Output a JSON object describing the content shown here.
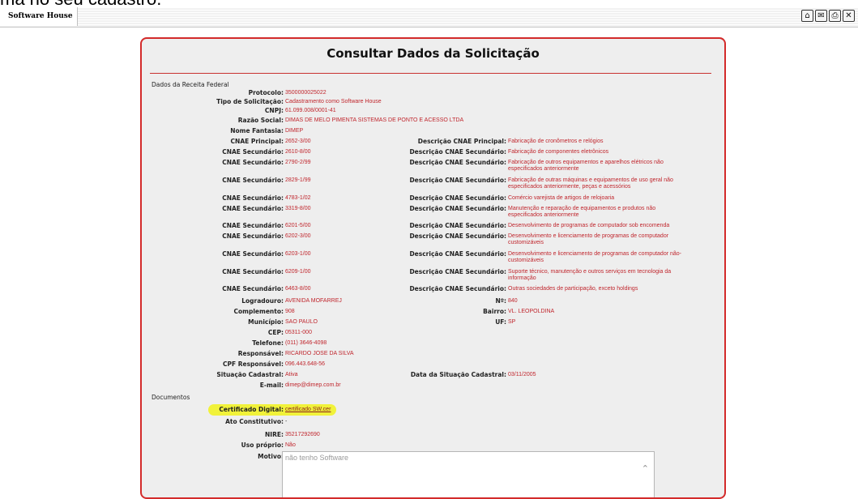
{
  "page": {
    "top_caption": "ma no seu cadastro.",
    "app_title": "Software House",
    "top_icons": [
      "home-icon",
      "mail-icon",
      "print-icon",
      "close-icon"
    ]
  },
  "panel": {
    "title": "Consultar Dados da Solicitação",
    "section_receita": "Dados da Receita Federal",
    "section_documentos": "Documentos"
  },
  "fields": {
    "protocolo": {
      "label": "Protocolo:",
      "value": "3500000025022"
    },
    "tipo": {
      "label": "Tipo de Solicitação:",
      "value": "Cadastramento como Software House"
    },
    "cnpj": {
      "label": "CNPJ:",
      "value": "61.099.008/0001-41"
    },
    "razao": {
      "label": "Razão Social:",
      "value": "DIMAS DE MELO PIMENTA SISTEMAS DE PONTO E ACESSO LTDA"
    },
    "fantasia": {
      "label": "Nome Fantasia:",
      "value": "DIMEP"
    },
    "cnae_principal": {
      "label": "CNAE Principal:",
      "value": "2652-3/00",
      "desc_label": "Descrição CNAE Principal:",
      "desc": "Fabricação de cronômetros e relógios"
    }
  },
  "cnae_secundarios": [
    {
      "label": "CNAE Secundário:",
      "value": "2610-8/00",
      "desc_label": "Descrição CNAE Secundário:",
      "desc": "Fabricação de componentes eletrônicos"
    },
    {
      "label": "CNAE Secundário:",
      "value": "2790-2/99",
      "desc_label": "Descrição CNAE Secundário:",
      "desc": "Fabricação de outros equipamentos e aparelhos elétricos não especificados anteriormente"
    },
    {
      "label": "CNAE Secundário:",
      "value": "2829-1/99",
      "desc_label": "Descrição CNAE Secundário:",
      "desc": "Fabricação de outras máquinas e equipamentos de uso geral não especificados anteriormente, peças e acessórios"
    },
    {
      "label": "CNAE Secundário:",
      "value": "4783-1/02",
      "desc_label": "Descrição CNAE Secundário:",
      "desc": "Comércio varejista de artigos de relojoaria"
    },
    {
      "label": "CNAE Secundário:",
      "value": "3319-8/00",
      "desc_label": "Descrição CNAE Secundário:",
      "desc": "Manutenção e reparação de equipamentos e produtos não especificados anteriormente"
    },
    {
      "label": "CNAE Secundário:",
      "value": "6201-5/00",
      "desc_label": "Descrição CNAE Secundário:",
      "desc": "Desenvolvimento de programas de computador sob encomenda"
    },
    {
      "label": "CNAE Secundário:",
      "value": "6202-3/00",
      "desc_label": "Descrição CNAE Secundário:",
      "desc": "Desenvolvimento e licenciamento de programas de computador customizáveis"
    },
    {
      "label": "CNAE Secundário:",
      "value": "6203-1/00",
      "desc_label": "Descrição CNAE Secundário:",
      "desc": "Desenvolvimento e licenciamento de programas de computador não-customizáveis"
    },
    {
      "label": "CNAE Secundário:",
      "value": "6209-1/00",
      "desc_label": "Descrição CNAE Secundário:",
      "desc": "Suporte técnico, manutenção e outros serviços em tecnologia da informação"
    },
    {
      "label": "CNAE Secundário:",
      "value": "6463-8/00",
      "desc_label": "Descrição CNAE Secundário:",
      "desc": "Outras sociedades de participação, exceto holdings"
    }
  ],
  "endereco": {
    "logradouro": {
      "label": "Logradouro:",
      "value": "AVENIDA MOFARREJ"
    },
    "numero": {
      "label": "Nº:",
      "value": "840"
    },
    "complemento": {
      "label": "Complemento:",
      "value": "908"
    },
    "bairro": {
      "label": "Bairro:",
      "value": "VL. LEOPOLDINA"
    },
    "municipio": {
      "label": "Município:",
      "value": "SAO PAULO"
    },
    "uf": {
      "label": "UF:",
      "value": "SP"
    },
    "cep": {
      "label": "CEP:",
      "value": "05311-000"
    },
    "telefone": {
      "label": "Telefone:",
      "value": "(011) 3646-4098"
    },
    "responsavel": {
      "label": "Responsável:",
      "value": "RICARDO JOSE DA SILVA"
    },
    "cpf": {
      "label": "CPF Responsável:",
      "value": "096.443.648-56"
    },
    "situacao": {
      "label": "Situação Cadastral:",
      "value": "Ativa"
    },
    "data_situacao": {
      "label": "Data da Situação Cadastral:",
      "value": "03/11/2005"
    },
    "email": {
      "label": "E-mail:",
      "value": "dimep@dimep.com.br"
    }
  },
  "documentos": {
    "certificado": {
      "label": "Certificado Digital:",
      "value": "certificado SW.cer"
    },
    "ato": {
      "label": "Ato Constitutivo:",
      "value": "-"
    },
    "nire": {
      "label": "NIRE:",
      "value": "35217292690"
    },
    "uso": {
      "label": "Uso próprio:",
      "value": "Não"
    },
    "motivo": {
      "label": "Motivo:",
      "value": "não tenho Software"
    }
  }
}
